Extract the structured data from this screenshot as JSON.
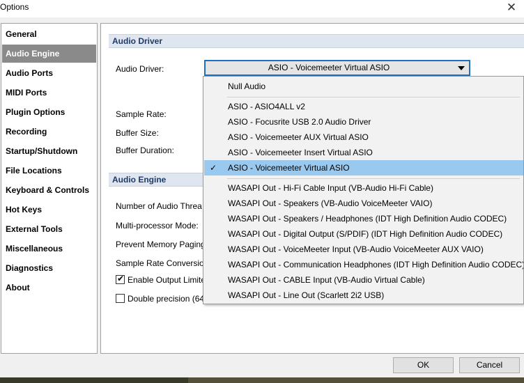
{
  "window": {
    "title": "Options",
    "close_glyph": "✕"
  },
  "sidebar": {
    "items": [
      {
        "label": "General"
      },
      {
        "label": "Audio Engine",
        "selected": true
      },
      {
        "label": "Audio Ports"
      },
      {
        "label": "MIDI Ports"
      },
      {
        "label": "Plugin Options"
      },
      {
        "label": "Recording"
      },
      {
        "label": "Startup/Shutdown"
      },
      {
        "label": "File Locations"
      },
      {
        "label": "Keyboard & Controls"
      },
      {
        "label": "Hot Keys"
      },
      {
        "label": "External Tools"
      },
      {
        "label": "Miscellaneous"
      },
      {
        "label": "Diagnostics"
      },
      {
        "label": "About"
      }
    ]
  },
  "audio_driver_section": {
    "header": "Audio Driver",
    "driver_label": "Audio Driver:",
    "driver_value": "ASIO - Voicemeeter Virtual ASIO",
    "sample_rate_label": "Sample Rate:",
    "buffer_size_label": "Buffer Size:",
    "buffer_duration_label": "Buffer Duration:"
  },
  "audio_engine_section": {
    "header": "Audio Engine",
    "threads_label": "Number of Audio Threa",
    "multiprocessor_label": "Multi-processor Mode:",
    "prevent_paging_label": "Prevent Memory Paging",
    "sample_rate_conversion_label": "Sample Rate Conversion",
    "enable_output_limiter_label": "Enable Output Limite",
    "enable_output_limiter_checked": true,
    "double_precision_label": "Double precision (64",
    "double_precision_checked": false
  },
  "dropdown": {
    "options": [
      {
        "label": "Null Audio"
      },
      {
        "label": "ASIO - ASIO4ALL v2"
      },
      {
        "label": "ASIO - Focusrite USB 2.0 Audio Driver"
      },
      {
        "label": "ASIO - Voicemeeter AUX Virtual ASIO"
      },
      {
        "label": "ASIO - Voicemeeter Insert Virtual ASIO"
      },
      {
        "label": "ASIO - Voicemeeter Virtual ASIO",
        "selected": true
      },
      {
        "label": "WASAPI Out - Hi-Fi Cable Input (VB-Audio Hi-Fi Cable)"
      },
      {
        "label": "WASAPI Out - Speakers (VB-Audio VoiceMeeter VAIO)"
      },
      {
        "label": "WASAPI Out - Speakers / Headphones (IDT High Definition Audio CODEC)"
      },
      {
        "label": "WASAPI Out - Digital Output (S/PDIF) (IDT High Definition Audio CODEC)"
      },
      {
        "label": "WASAPI Out - VoiceMeeter Input (VB-Audio VoiceMeeter AUX VAIO)"
      },
      {
        "label": "WASAPI Out - Communication Headphones (IDT High Definition Audio CODEC)"
      },
      {
        "label": "WASAPI Out - CABLE Input (VB-Audio Virtual Cable)"
      },
      {
        "label": "WASAPI Out - Line Out (Scarlett 2i2 USB)"
      }
    ]
  },
  "buttons": {
    "ok": "OK",
    "cancel": "Cancel"
  },
  "colors": {
    "selected_sidebar": "#8a8a8a",
    "selected_option": "#99c9ef",
    "section_header_text": "#1e3a66"
  }
}
